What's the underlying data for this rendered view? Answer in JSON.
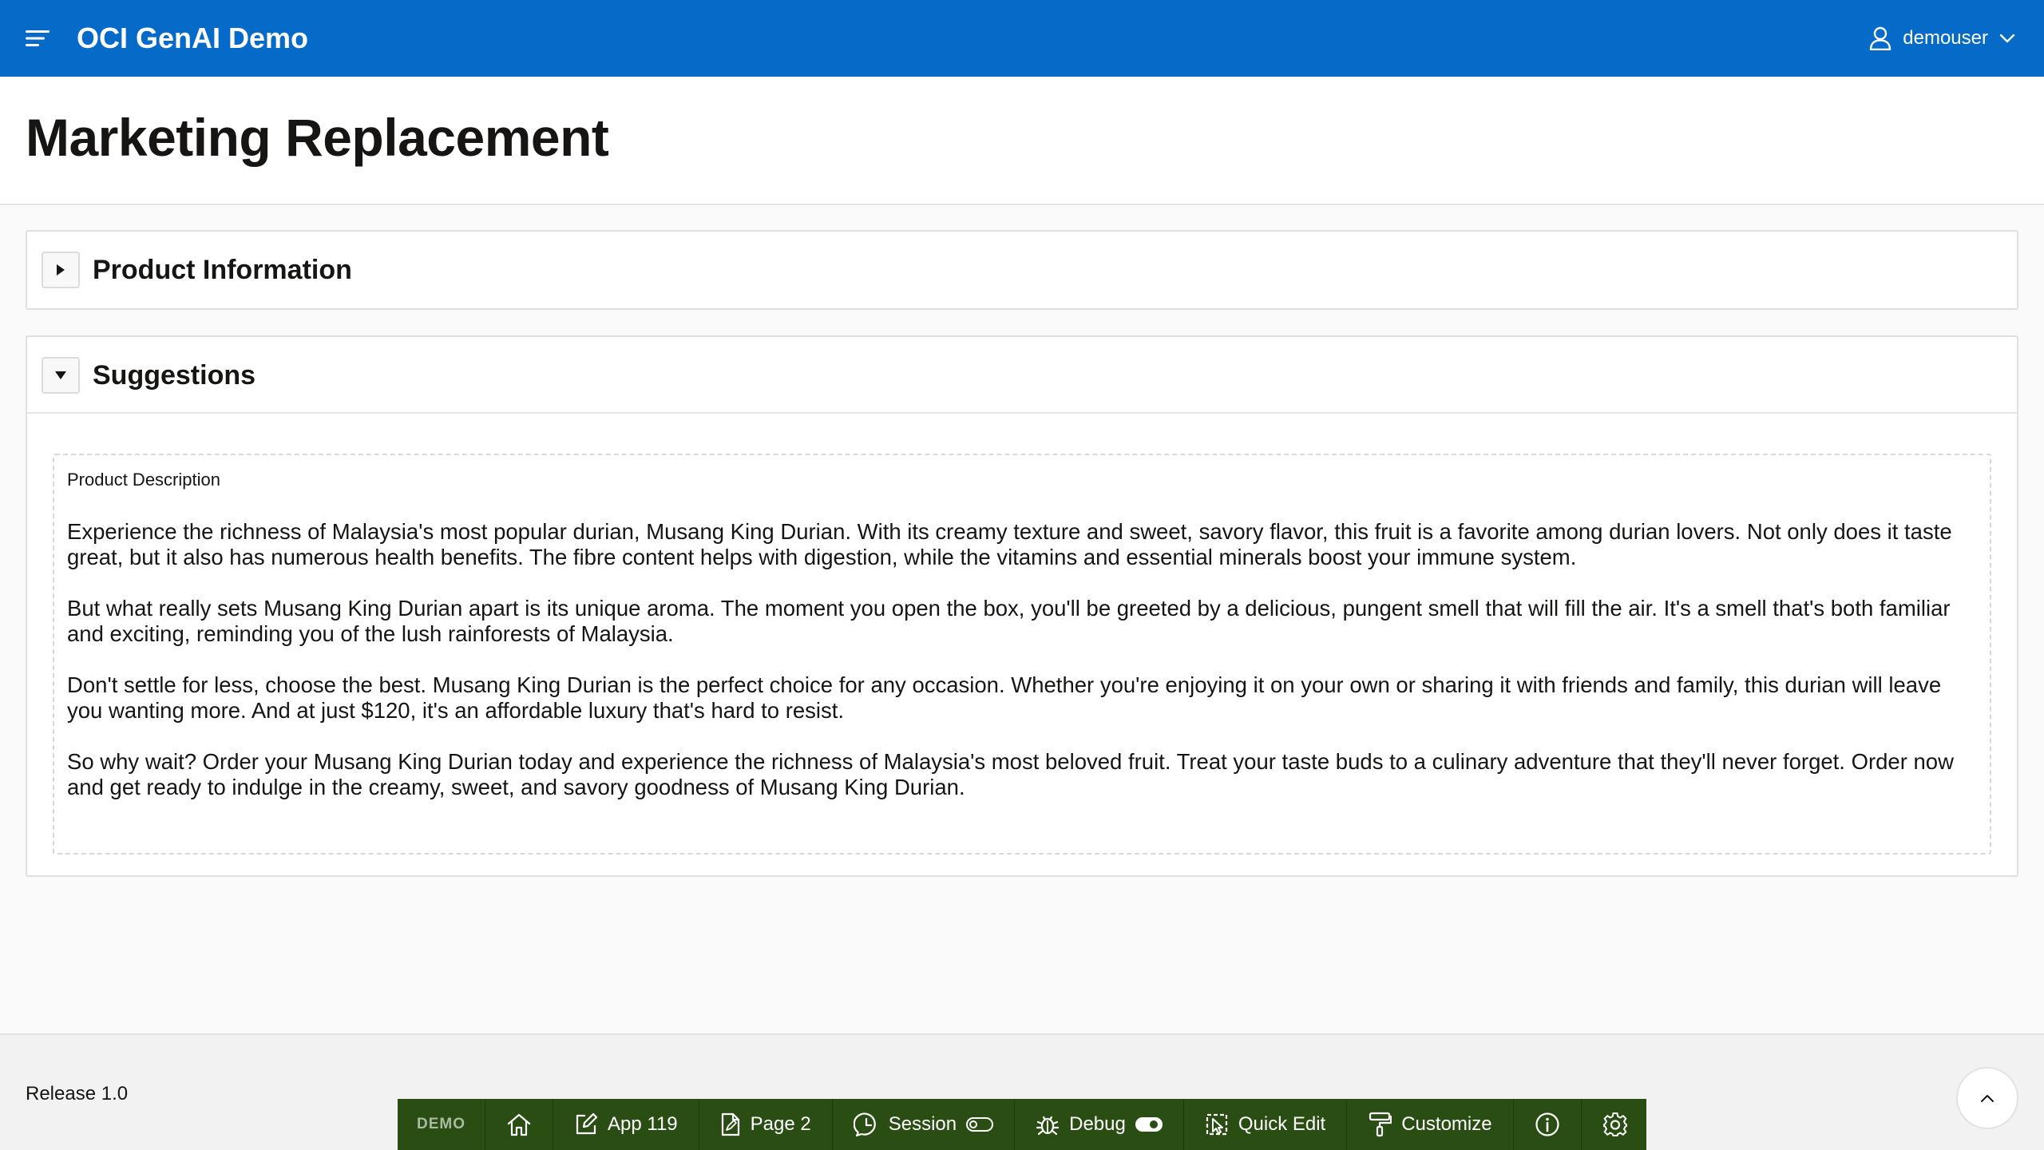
{
  "header": {
    "app_title": "OCI GenAI Demo",
    "user_name": "demouser",
    "accent_color": "#056ac8"
  },
  "page": {
    "title": "Marketing Replacement"
  },
  "regions": {
    "product_information": {
      "title": "Product Information",
      "expanded": false
    },
    "suggestions": {
      "title": "Suggestions",
      "expanded": true,
      "field_label": "Product Description",
      "paragraphs": [
        "Experience the richness of Malaysia's most popular durian, Musang King Durian. With its creamy texture and sweet, savory flavor, this fruit is a favorite among durian lovers. Not only does it taste great, but it also has numerous health benefits. The fibre content helps with digestion, while the vitamins and essential minerals boost your immune system.",
        "But what really sets Musang King Durian apart is its unique aroma. The moment you open the box, you'll be greeted by a delicious, pungent smell that will fill the air. It's a smell that's both familiar and exciting, reminding you of the lush rainforests of Malaysia.",
        "Don't settle for less, choose the best. Musang King Durian is the perfect choice for any occasion. Whether you're enjoying it on your own or sharing it with friends and family, this durian will leave you wanting more. And at just $120, it's an affordable luxury that's hard to resist.",
        "So why wait? Order your Musang King Durian today and experience the richness of Malaysia's most beloved fruit. Treat your taste buds to a culinary adventure that they'll never forget. Order now and get ready to indulge in the creamy, sweet, and savory goodness of Musang King Durian."
      ]
    }
  },
  "footer": {
    "release": "Release 1.0"
  },
  "dev_toolbar": {
    "background_color": "#2a4d14",
    "demo_label": "DEMO",
    "app_label": "App 119",
    "page_label": "Page 2",
    "session_label": "Session",
    "debug_label": "Debug",
    "quick_edit_label": "Quick Edit",
    "customize_label": "Customize",
    "icons": [
      "home-icon",
      "edit-icon",
      "page-icon",
      "session-icon",
      "bug-icon",
      "quick-edit-icon",
      "paint-roller-icon",
      "info-icon",
      "gear-icon"
    ]
  }
}
